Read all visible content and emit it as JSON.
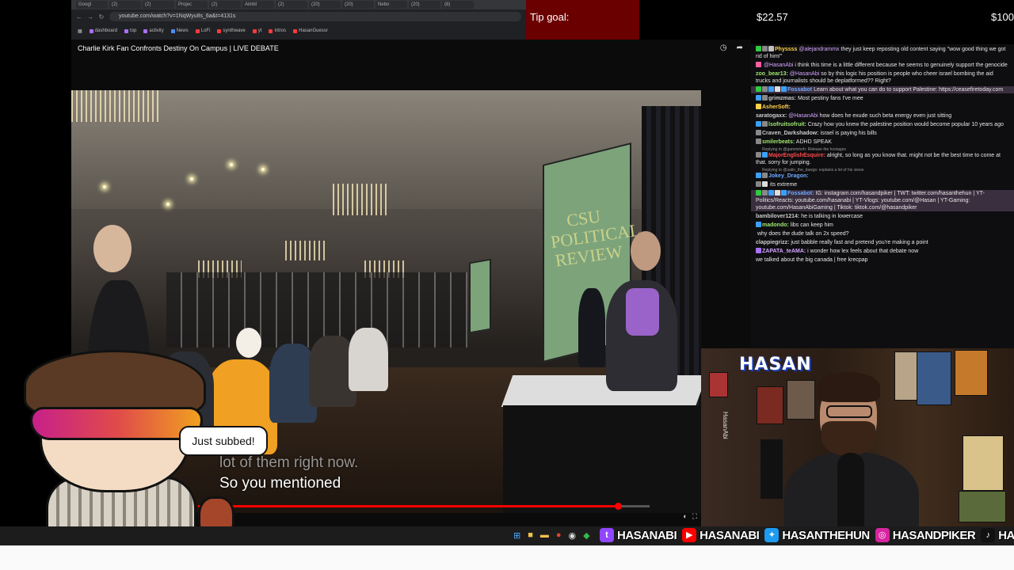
{
  "browser": {
    "tabs": [
      "Googl",
      "(2)",
      "(2)",
      "Projec",
      "(2)",
      "Aimbl",
      "(2)",
      "(20)",
      "(20)",
      "Nebo",
      "(20)",
      "(8)"
    ],
    "url": "youtube.com/watch?v=1NqWyu8s_6a&t=4131s",
    "bookmarks": [
      {
        "label": "dashboard",
        "color": "#a970ff"
      },
      {
        "label": "top",
        "color": "#a970ff"
      },
      {
        "label": "activity",
        "color": "#a970ff"
      },
      {
        "label": "News",
        "color": "#4a8cff"
      },
      {
        "label": "LoFi",
        "color": "#ff3a3a"
      },
      {
        "label": "synthwave",
        "color": "#ff3a3a"
      },
      {
        "label": "yt",
        "color": "#ff3a3a"
      },
      {
        "label": "intros",
        "color": "#ff3a3a"
      },
      {
        "label": "HasanGuessr",
        "color": "#ff3a3a"
      }
    ]
  },
  "tip": {
    "label": "Tip goal:",
    "current": "$22.57",
    "goal": "$100"
  },
  "video": {
    "title": "Charlie Kirk Fan Confronts Destiny On Campus | LIVE DEBATE",
    "screen_text": "CSU POLITICAL REVIEW",
    "caption_prev": "lot of them right now.",
    "caption_line": "So you mentioned",
    "progress": 0.93
  },
  "avatar": {
    "bubble": "Just subbed!"
  },
  "chat": [
    {
      "user": "Physsss",
      "color": "#ffd24a",
      "mention": "@alejandrammx",
      "text": " they just keep reposting old content saying \"wow good thing we got rid of him!\"",
      "badges": [
        "#2ecc40",
        "#888",
        "#c0c0c0"
      ],
      "wrap": true
    },
    {
      "user": "",
      "color": "#ff5fa2",
      "mention": "@HasanAbi",
      "text": " i think this time is a little different because he seems to genuinely support the genocide",
      "badges": [
        "#ff5fa2"
      ],
      "wrap": true,
      "hl": false
    },
    {
      "user": "zoo_bear13:",
      "color": "#9fe870",
      "mention": "@HasanAbi",
      "text": " so by this logic his position is people who cheer israel bombing the aid trucks and journalists should be deplatformed?? Right?",
      "badges": [],
      "wrap": true
    },
    {
      "user": "Fossabot",
      "color": "#6ea8ff",
      "mention": "",
      "text": " Learn about what you can do to support Palestine: https://ceasefiretoday.com",
      "badges": [
        "#2ecc40",
        "#888",
        "#3aa0ff",
        "#ddd",
        "#3aa0ff"
      ],
      "wrap": true,
      "hl": true
    },
    {
      "user": "grimzmas:",
      "color": "#cccccc",
      "mention": "",
      "text": " Most pestiny fans I've mee",
      "badges": [
        "#3aa0ff",
        "#888"
      ],
      "wrap": false
    },
    {
      "user": "AsherSoft:",
      "color": "#ffd24a",
      "mention": "",
      "text": " ",
      "badges": [
        "#ffd24a"
      ],
      "wrap": false
    },
    {
      "user": "saratogaxx:",
      "color": "#cccccc",
      "mention": "@HasanAbi",
      "text": " how does he exude such beta energy even just sitting",
      "badges": [],
      "wrap": false
    },
    {
      "user": "lsofruitsofruit:",
      "color": "#9fe870",
      "mention": "",
      "text": " Crazy how you knew the palestine position would become popular 10 years ago",
      "badges": [
        "#3aa0ff",
        "#888"
      ],
      "wrap": false
    },
    {
      "user": "Craven_Darkshadow:",
      "color": "#cccccc",
      "mention": "",
      "text": " israel is paying his bills",
      "badges": [
        "#888"
      ],
      "wrap": false
    },
    {
      "user": "smilerbeats:",
      "color": "#9fe870",
      "mention": "",
      "text": " ADHD SPEAK",
      "badges": [
        "#888"
      ],
      "wrap": false
    },
    {
      "user": "MajorEnglishEsquire:",
      "color": "#ff4a4a",
      "mention": "",
      "text": " alright, so long as you know that. might not be the best time to come at that. sorry for jumping.",
      "badges": [
        "#888",
        "#3aa0ff"
      ],
      "wrap": true,
      "reply": "Replying to @gamminoh: Release the hostages"
    },
    {
      "user": "Jokey_Dragon:",
      "color": "#6ea8ff",
      "mention": "",
      "text": " ",
      "badges": [
        "#3aa0ff",
        "#888"
      ],
      "wrap": false,
      "reply": "Replying to @satin_the_dawgs: explains a lot of his views"
    },
    {
      "user": "",
      "color": "#ff4a4a",
      "mention": "",
      "text": " its extreme",
      "badges": [
        "#888",
        "#ddd"
      ],
      "wrap": false
    },
    {
      "user": "Fossabot:",
      "color": "#6ea8ff",
      "mention": "",
      "text": " IG: instagram.com/hasandpiker | TWT: twitter.com/hasanthehun | YT-Politics/Reacts: youtube.com/hasanabi | YT-Vlogs: youtube.com/@Hasan | YT-Gaming: youtube.com/HasanAbiGaming | Tiktok: tiktok.com/@hasandpiker",
      "badges": [
        "#2ecc40",
        "#888",
        "#3aa0ff",
        "#ddd",
        "#3aa0ff"
      ],
      "wrap": true,
      "hl": true
    },
    {
      "user": "bambilover1214:",
      "color": "#cccccc",
      "mention": "",
      "text": " he is talking in lowercase",
      "badges": [],
      "wrap": false
    },
    {
      "user": "madondo:",
      "color": "#9fe870",
      "mention": "",
      "text": " libs can keep him",
      "badges": [
        "#3aa0ff"
      ],
      "wrap": false
    },
    {
      "user": "",
      "color": "#ff4a4a",
      "mention": "",
      "text": " why does the dude talk on 2x speed?",
      "badges": [],
      "wrap": false
    },
    {
      "user": "clappiegrizz:",
      "color": "#cccccc",
      "mention": "",
      "text": " just babble really fast and pretend you're making a point",
      "badges": [],
      "wrap": false
    },
    {
      "user": "ZAPATA_teAMA:",
      "color": "#d5a6ff",
      "mention": "",
      "text": " i wonder how lex feels about that debate now",
      "badges": [
        "#a970ff"
      ],
      "wrap": false
    },
    {
      "user": "",
      "color": "#cccccc",
      "mention": "",
      "text": "we talked about the big canada | free krecpap",
      "badges": [],
      "wrap": false
    }
  ],
  "cam": {
    "sign": "HASAN",
    "side_label": "HasanAbi"
  },
  "taskbar": {
    "icons": [
      {
        "name": "windows-start-icon",
        "glyph": "⊞",
        "color": "#4aa8ff"
      },
      {
        "name": "file-explorer-icon",
        "glyph": "■",
        "color": "#f2c14e"
      },
      {
        "name": "folder-icon",
        "glyph": "▬",
        "color": "#f2c14e"
      },
      {
        "name": "chrome-icon",
        "glyph": "●",
        "color": "#e34133"
      },
      {
        "name": "obs-icon",
        "glyph": "◉",
        "color": "#ddd"
      },
      {
        "name": "app-icon",
        "glyph": "◆",
        "color": "#39b54a"
      }
    ],
    "socials": [
      {
        "name": "twitch-icon",
        "glyph": "t",
        "color": "#9146ff",
        "handle": "HASANABI"
      },
      {
        "name": "youtube-icon",
        "glyph": "▶",
        "color": "#ff0000",
        "handle": "HASANABI"
      },
      {
        "name": "twitter-icon",
        "glyph": "✦",
        "color": "#1d9bf0",
        "handle": "HASANTHEHUN"
      },
      {
        "name": "instagram-icon",
        "glyph": "◎",
        "color": "#d6249f",
        "handle": "HASANDPIKER"
      },
      {
        "name": "tiktok-icon",
        "glyph": "♪",
        "color": "#111",
        "handle": "HASAND"
      }
    ]
  }
}
